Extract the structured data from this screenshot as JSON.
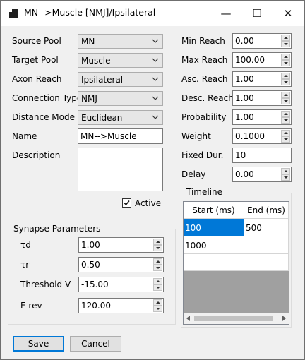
{
  "window": {
    "title": "MN-->Muscle [NMJ]/Ipsilateral",
    "minimize": "—",
    "maximize": "☐",
    "close": "✕"
  },
  "left": {
    "source_pool": {
      "label": "Source Pool",
      "value": "MN"
    },
    "target_pool": {
      "label": "Target Pool",
      "value": "Muscle"
    },
    "axon_reach": {
      "label": "Axon Reach",
      "value": "Ipsilateral"
    },
    "connection_type": {
      "label": "Connection Type",
      "value": "NMJ"
    },
    "distance_mode": {
      "label": "Distance Mode",
      "value": "Euclidean"
    },
    "name": {
      "label": "Name",
      "value": "MN-->Muscle"
    },
    "description": {
      "label": "Description",
      "value": ""
    },
    "active": {
      "label": "Active",
      "checked": true
    }
  },
  "right": {
    "min_reach": {
      "label": "Min Reach",
      "value": "0.00"
    },
    "max_reach": {
      "label": "Max Reach",
      "value": "100.00"
    },
    "asc_reach": {
      "label": "Asc. Reach",
      "value": "1.00"
    },
    "desc_reach": {
      "label": "Desc. Reach",
      "value": "1.00"
    },
    "probability": {
      "label": "Probability",
      "value": "1.00"
    },
    "weight": {
      "label": "Weight",
      "value": "0.1000"
    },
    "fixed_dur": {
      "label": "Fixed Dur.",
      "value": "10"
    },
    "delay": {
      "label": "Delay",
      "value": "0.00"
    }
  },
  "synapse": {
    "title": "Synapse Parameters",
    "td": {
      "label": "τd",
      "value": "1.00"
    },
    "tr": {
      "label": "τr",
      "value": "0.50"
    },
    "threshold": {
      "label": "Threshold V",
      "value": "-15.00"
    },
    "erev": {
      "label": "E rev",
      "value": "120.00"
    }
  },
  "timeline": {
    "title": "Timeline",
    "columns": [
      "Start (ms)",
      "End (ms)"
    ],
    "rows": [
      [
        "100",
        "500"
      ],
      [
        "1000",
        ""
      ],
      [
        "",
        ""
      ]
    ]
  },
  "buttons": {
    "save": "Save",
    "cancel": "Cancel"
  },
  "colors": {
    "selection": "#0078d7",
    "focus_border": "#0078d7"
  }
}
